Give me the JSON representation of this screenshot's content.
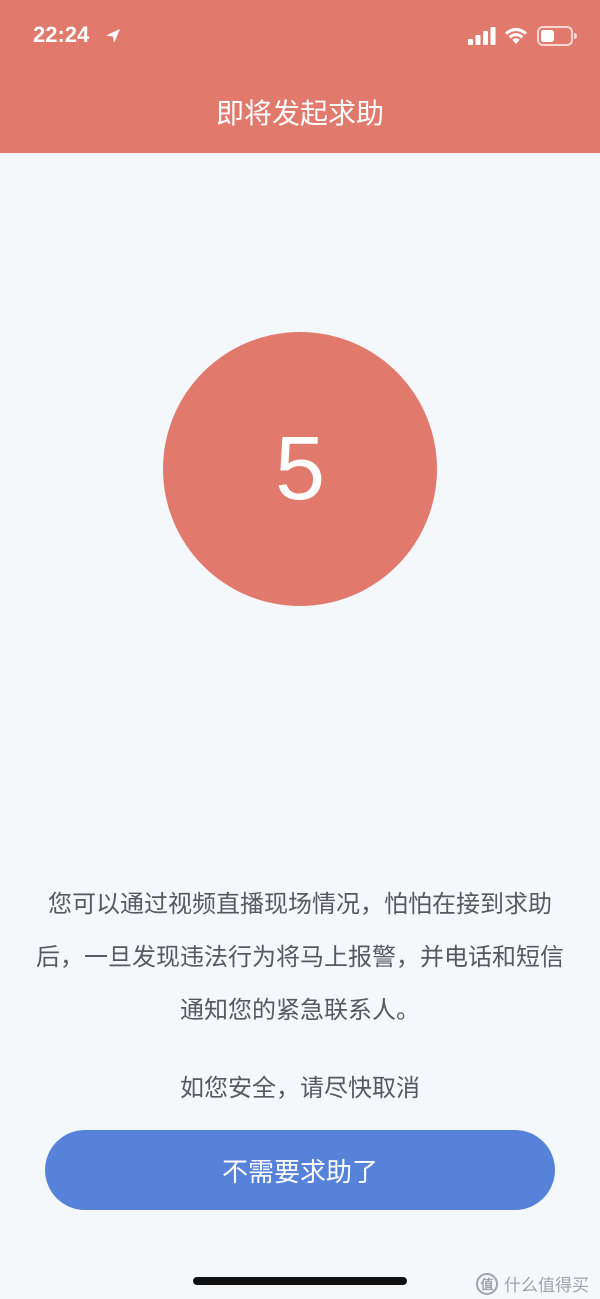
{
  "status_bar": {
    "time": "22:24",
    "icons": [
      "location-arrow-icon",
      "cellular-signal-icon",
      "wifi-icon",
      "battery-icon"
    ]
  },
  "header": {
    "title": "即将发起求助",
    "background_color": "#e17a6d"
  },
  "countdown": {
    "value": "5",
    "circle_color": "#e17a6d"
  },
  "description": {
    "lines": [
      "您可以通过视频直播现场情况，怕怕在接到求助",
      "后，一旦发现违法行为将马上报警，并电话和短信",
      "通知您的紧急联系人。"
    ]
  },
  "safe_note": "如您安全，请尽快取消",
  "cancel_button": {
    "label": "不需要求助了",
    "color": "#5782d9"
  },
  "watermark": {
    "icon_glyph": "值",
    "text": "什么值得买"
  }
}
